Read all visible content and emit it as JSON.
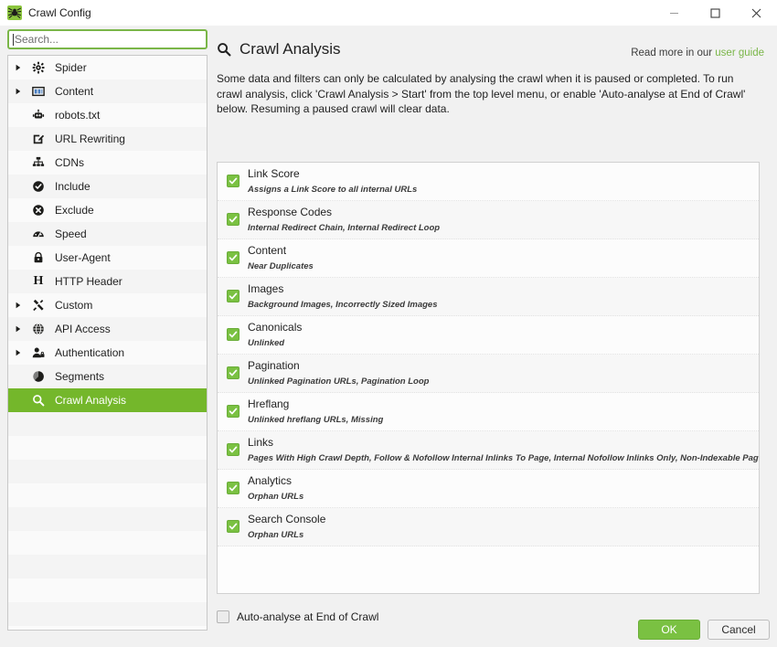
{
  "window": {
    "title": "Crawl Config",
    "icon": "spider-icon",
    "controls": {
      "minimize": "minimize-icon",
      "maximize": "maximize-icon",
      "close": "close-icon"
    }
  },
  "sidebar": {
    "search": {
      "value": "",
      "placeholder": "Search...",
      "icon": "search-icon"
    },
    "items": [
      {
        "label": "Spider",
        "icon": "gear-icon",
        "expandable": true,
        "indent": 0,
        "selected": false
      },
      {
        "label": "Content",
        "icon": "columns-icon",
        "expandable": true,
        "indent": 0,
        "selected": false
      },
      {
        "label": "robots.txt",
        "icon": "robot-icon",
        "expandable": false,
        "indent": 1,
        "selected": false
      },
      {
        "label": "URL Rewriting",
        "icon": "edit-icon",
        "expandable": false,
        "indent": 1,
        "selected": false
      },
      {
        "label": "CDNs",
        "icon": "sitemap-icon",
        "expandable": false,
        "indent": 1,
        "selected": false
      },
      {
        "label": "Include",
        "icon": "check-circle-icon",
        "expandable": false,
        "indent": 1,
        "selected": false
      },
      {
        "label": "Exclude",
        "icon": "x-circle-icon",
        "expandable": false,
        "indent": 1,
        "selected": false
      },
      {
        "label": "Speed",
        "icon": "gauge-icon",
        "expandable": false,
        "indent": 1,
        "selected": false
      },
      {
        "label": "User-Agent",
        "icon": "lock-icon",
        "expandable": false,
        "indent": 1,
        "selected": false
      },
      {
        "label": "HTTP Header",
        "icon": "letter-h-icon",
        "expandable": false,
        "indent": 1,
        "selected": false
      },
      {
        "label": "Custom",
        "icon": "tools-icon",
        "expandable": true,
        "indent": 0,
        "selected": false
      },
      {
        "label": "API Access",
        "icon": "globe-icon",
        "expandable": true,
        "indent": 0,
        "selected": false
      },
      {
        "label": "Authentication",
        "icon": "user-lock-icon",
        "expandable": true,
        "indent": 0,
        "selected": false
      },
      {
        "label": "Segments",
        "icon": "pie-chart-icon",
        "expandable": false,
        "indent": 1,
        "selected": false
      },
      {
        "label": "Crawl Analysis",
        "icon": "search-icon",
        "expandable": false,
        "indent": 1,
        "selected": true
      }
    ]
  },
  "main": {
    "header": {
      "icon": "search-icon",
      "title": "Crawl Analysis",
      "read_more_prefix": "Read more in our ",
      "read_more_link": "user guide"
    },
    "description": "Some data and filters can only be calculated by analysing the crawl when it is paused or completed. To run crawl analysis, click 'Crawl Analysis > Start' from the top level menu, or enable 'Auto-analyse at End of Crawl' below. Resuming a paused crawl will clear data.",
    "options": [
      {
        "label": "Link Score",
        "sub": "Assigns a Link Score to all internal URLs",
        "checked": true
      },
      {
        "label": "Response Codes",
        "sub": "Internal Redirect Chain, Internal Redirect Loop",
        "checked": true
      },
      {
        "label": "Content",
        "sub": "Near Duplicates",
        "checked": true
      },
      {
        "label": "Images",
        "sub": "Background Images, Incorrectly Sized Images",
        "checked": true
      },
      {
        "label": "Canonicals",
        "sub": "Unlinked",
        "checked": true
      },
      {
        "label": "Pagination",
        "sub": "Unlinked Pagination URLs, Pagination Loop",
        "checked": true
      },
      {
        "label": "Hreflang",
        "sub": "Unlinked hreflang URLs, Missing",
        "checked": true
      },
      {
        "label": "Links",
        "sub": "Pages With High Crawl Depth, Follow & Nofollow Internal Inlinks To Page, Internal Nofollow Inlinks Only, Non-Indexable Page Inlinks Only",
        "checked": true
      },
      {
        "label": "Analytics",
        "sub": "Orphan URLs",
        "checked": true
      },
      {
        "label": "Search Console",
        "sub": "Orphan URLs",
        "checked": true
      }
    ],
    "auto_analyse": {
      "label": "Auto-analyse at End of Crawl",
      "checked": false
    }
  },
  "footer": {
    "ok_label": "OK",
    "cancel_label": "Cancel"
  },
  "colors": {
    "accent_green": "#7ac142",
    "selection_green": "#74b72b",
    "link_green": "#7ab648"
  }
}
